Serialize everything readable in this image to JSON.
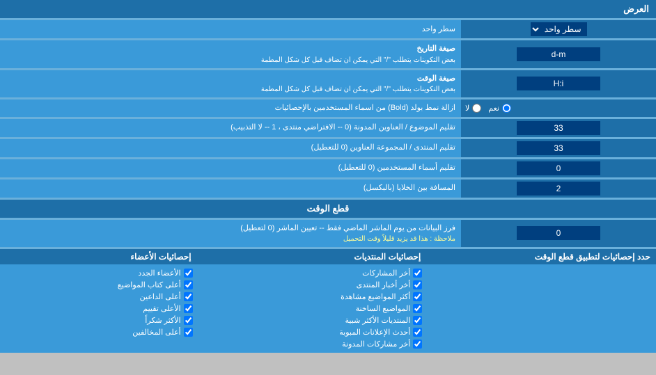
{
  "title": "العرض",
  "rows": [
    {
      "label": "سطر واحد",
      "label_notes": "",
      "type": "select",
      "value": "سطر واحد",
      "colspan": false
    },
    {
      "label": "صيغة التاريخ",
      "label_notes": "بعض التكوينات يتطلب \"/\" التي يمكن ان تضاف قبل كل شكل المطمة",
      "type": "input",
      "value": "d-m"
    },
    {
      "label": "صيغة الوقت",
      "label_notes": "بعض التكوينات يتطلب \"/\" التي يمكن ان تضاف قبل كل شكل المطمة",
      "type": "input",
      "value": "H:i"
    },
    {
      "label": "ازالة نمط بولد (Bold) من اسماء المستخدمين بالإحصائيات",
      "type": "radio",
      "options": [
        "نعم",
        "لا"
      ],
      "selected": "نعم"
    },
    {
      "label": "تقليم الموضوع / العناوين المدونة (0 -- الافتراضي منتدى ، 1 -- لا التذبيب)",
      "type": "input",
      "value": "33"
    },
    {
      "label": "تقليم المنتدى / المجموعة العناوين (0 للتعطيل)",
      "type": "input",
      "value": "33"
    },
    {
      "label": "تقليم أسماء المستخدمين (0 للتعطيل)",
      "type": "input",
      "value": "0"
    },
    {
      "label": "المسافة بين الخلايا (بالبكسل)",
      "type": "input",
      "value": "2"
    }
  ],
  "cutoff_section": {
    "title": "قطع الوقت",
    "field_label": "فرز البيانات من يوم الماشر الماضي فقط -- تعيين الماشر (0 لتعطيل)",
    "field_note": "ملاحظة : هذا قد يزيد قليلاً وقت التحميل",
    "value": "0"
  },
  "stats_section": {
    "header": "حدد إحصائيات لتطبيق قطع الوقت",
    "col1_header": "إحصائيات الأعضاء",
    "col2_header": "إحصائيات المنتديات",
    "col1_items": [
      "الأعضاء الجدد",
      "أعلى كتاب المواضيع",
      "أعلى الداعين",
      "الأعلى تقييم",
      "الأكثر شكراً",
      "أعلى المخالفين"
    ],
    "col2_items": [
      "أخر المشاركات",
      "أخر أخبار المنتدى",
      "أكثر المواضيع مشاهدة",
      "المواضيع الساخنة",
      "المنتديات الأكثر شبية",
      "أحدث الإعلانات المبوبة",
      "أخر مشاركات المدونة"
    ]
  }
}
